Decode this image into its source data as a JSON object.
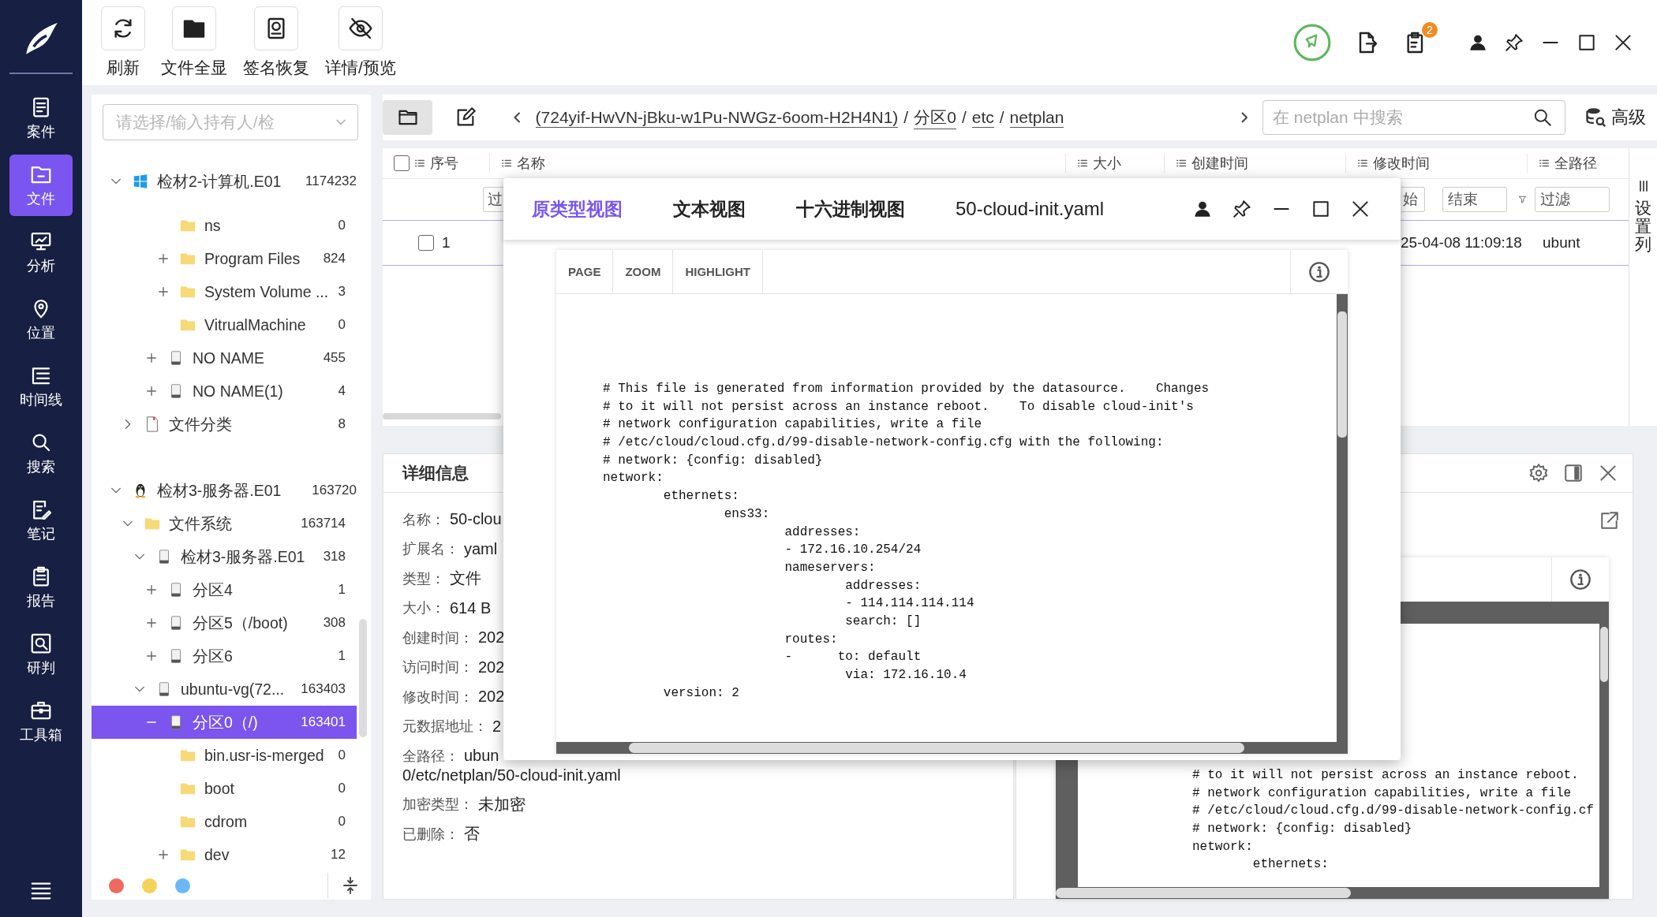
{
  "nav": {
    "items": [
      {
        "label": "案件",
        "selected": false
      },
      {
        "label": "文件",
        "selected": true
      },
      {
        "label": "分析",
        "selected": false
      },
      {
        "label": "位置",
        "selected": false
      },
      {
        "label": "时间线",
        "selected": false
      },
      {
        "label": "搜索",
        "selected": false
      },
      {
        "label": "笔记",
        "selected": false
      },
      {
        "label": "报告",
        "selected": false
      },
      {
        "label": "研判",
        "selected": false
      },
      {
        "label": "工具箱",
        "selected": false
      }
    ]
  },
  "toolbar": {
    "buttons": [
      "刷新",
      "文件全显",
      "签名恢复",
      "详情/预览"
    ],
    "badge": "2"
  },
  "tree": {
    "select_placeholder": "请选择/输入持有人/检",
    "nodes": [
      {
        "label": "检材2-计算机.E01",
        "count": "1174232",
        "kind": "windows",
        "expander": {
          "kind": "chevron",
          "expanded": true
        },
        "selected": false,
        "children": [
          {
            "children": [
              {
                "children": [
                  {
                    "children": [
                      {
                        "label": "ns",
                        "count": "0",
                        "kind": "folder",
                        "selected": false
                      },
                      {
                        "label": "Program Files",
                        "count": "824",
                        "kind": "folder",
                        "expander": {
                          "kind": "plus",
                          "expanded": false
                        },
                        "selected": false
                      },
                      {
                        "label": "System Volume ...",
                        "count": "3",
                        "kind": "folder",
                        "expander": {
                          "kind": "plus",
                          "expanded": false
                        },
                        "selected": false
                      },
                      {
                        "label": "VitrualMachine",
                        "count": "0",
                        "kind": "folder",
                        "selected": false
                      }
                    ]
                  },
                  {
                    "label": "NO NAME",
                    "count": "455",
                    "kind": "disk",
                    "expander": {
                      "kind": "plus",
                      "expanded": false
                    },
                    "selected": false
                  },
                  {
                    "label": "NO NAME(1)",
                    "count": "4",
                    "kind": "disk",
                    "expander": {
                      "kind": "plus",
                      "expanded": false
                    },
                    "selected": false
                  }
                ]
              }
            ]
          },
          {
            "label": "文件分类",
            "count": "8",
            "kind": "document",
            "expander": {
              "kind": "chevron",
              "expanded": false
            },
            "selected": false
          }
        ]
      },
      {
        "label": "检材3-服务器.E01",
        "count": "163720",
        "kind": "linux",
        "expander": {
          "kind": "chevron",
          "expanded": true
        },
        "selected": false,
        "children": [
          {
            "label": "文件系统",
            "count": "163714",
            "kind": "folder",
            "expander": {
              "kind": "chevron",
              "expanded": true
            },
            "selected": false,
            "children": [
              {
                "label": "检材3-服务器.E01",
                "count": "318",
                "kind": "disk",
                "expander": {
                  "kind": "chevron",
                  "expanded": true
                },
                "selected": false,
                "children": [
                  {
                    "label": "分区4",
                    "count": "1",
                    "kind": "disk",
                    "expander": {
                      "kind": "plus",
                      "expanded": false
                    },
                    "selected": false
                  },
                  {
                    "label": "分区5（/boot)",
                    "count": "308",
                    "kind": "disk",
                    "expander": {
                      "kind": "plus",
                      "expanded": false
                    },
                    "selected": false
                  },
                  {
                    "label": "分区6",
                    "count": "1",
                    "kind": "disk",
                    "expander": {
                      "kind": "plus",
                      "expanded": false
                    },
                    "selected": false
                  }
                ]
              },
              {
                "label": "ubuntu-vg(72...",
                "count": "163403",
                "kind": "disk",
                "expander": {
                  "kind": "chevron",
                  "expanded": true
                },
                "selected": false,
                "children": [
                  {
                    "label": "分区0（/)",
                    "count": "163401",
                    "kind": "disk",
                    "expander": {
                      "kind": "plus",
                      "expanded": true
                    },
                    "selected": true,
                    "children": [
                      {
                        "label": "bin.usr-is-merged",
                        "count": "0",
                        "kind": "folder",
                        "selected": false
                      },
                      {
                        "label": "boot",
                        "count": "0",
                        "kind": "folder",
                        "selected": false
                      },
                      {
                        "label": "cdrom",
                        "count": "0",
                        "kind": "folder",
                        "selected": false
                      },
                      {
                        "label": "dev",
                        "count": "12",
                        "kind": "folder",
                        "expander": {
                          "kind": "plus",
                          "expanded": false
                        },
                        "selected": false
                      }
                    ]
                  }
                ]
              }
            ]
          }
        ]
      }
    ],
    "color_filters": [
      {
        "color": "#ee6b5f"
      },
      {
        "color": "#f6d25b"
      },
      {
        "color": "#6cb8f6"
      }
    ]
  },
  "breadcrumb": {
    "view_buttons": [
      {
        "selected": true
      },
      {
        "selected": false
      }
    ],
    "segments": [
      "(724yif-HwVN-jBku-w1Pu-NWGz-6oom-H2H4N1)",
      "分区0",
      "etc",
      "netplan"
    ],
    "separators": [
      "/",
      "/",
      "/"
    ],
    "search_placeholder": "在 netplan 中搜索",
    "advanced": "高级"
  },
  "table": {
    "select_all_checked": false,
    "columns": [
      "序号",
      "名称",
      "大小",
      "创建时间",
      "修改时间",
      "全路径"
    ],
    "filters": [
      {
        "placeholder": "过"
      },
      {
        "placeholder": "始"
      },
      {
        "placeholder": "结束"
      },
      {
        "placeholder": "过滤"
      }
    ],
    "rows": [
      {
        "checked": false,
        "cells": [
          "1",
          "",
          "",
          "",
          "25-04-08 11:09:18",
          "ubunt"
        ]
      }
    ],
    "column_settings": "设置列"
  },
  "details": {
    "title": "详细信息",
    "fields": [
      {
        "label": "名称：",
        "value": "50-clou"
      },
      {
        "label": "扩展名：",
        "value": "yaml"
      },
      {
        "label": "类型：",
        "value": "文件"
      },
      {
        "label": "大小：",
        "value": "614 B"
      },
      {
        "label": "创建时间：",
        "value": "202"
      },
      {
        "label": "访问时间：",
        "value": "202"
      },
      {
        "label": "修改时间：",
        "value": "202"
      },
      {
        "label": "元数据地址：",
        "value": "2"
      },
      {
        "label": "全路径：",
        "value": "ubun",
        "continuation": "0/etc/netplan/50-cloud-init.yaml"
      },
      {
        "label": "加密类型：",
        "value": "未加密"
      },
      {
        "label": "已删除：",
        "value": "否"
      }
    ]
  },
  "preview": {
    "lines": [
      "# to it will not persist across an instance reboot.",
      "# network configuration capabilities, write a file",
      "# /etc/cloud/cloud.cfg.d/99-disable-network-config.cf",
      "# network: {config: disabled}",
      "network:",
      "        ethernets:"
    ]
  },
  "viewer_window": {
    "tabs": [
      {
        "label": "原类型视图",
        "selected": true
      },
      {
        "label": "文本视图",
        "selected": false
      },
      {
        "label": "十六进制视图",
        "selected": false
      }
    ],
    "title": "50-cloud-init.yaml",
    "tools": [
      "PAGE",
      "ZOOM",
      "HIGHLIGHT"
    ],
    "lines": [
      "# This file is generated from information provided by the datasource.    Changes",
      "# to it will not persist across an instance reboot.    To disable cloud-init's",
      "# network configuration capabilities, write a file",
      "# /etc/cloud/cloud.cfg.d/99-disable-network-config.cfg with the following:",
      "# network: {config: disabled}",
      "network:",
      "        ethernets:",
      "                ens33:",
      "                        addresses:",
      "                        - 172.16.10.254/24",
      "                        nameservers:",
      "                                addresses:",
      "                                - 114.114.114.114",
      "                                search: []",
      "                        routes:",
      "                        -      to: default",
      "                                via: 172.16.10.4",
      "        version: 2"
    ]
  }
}
